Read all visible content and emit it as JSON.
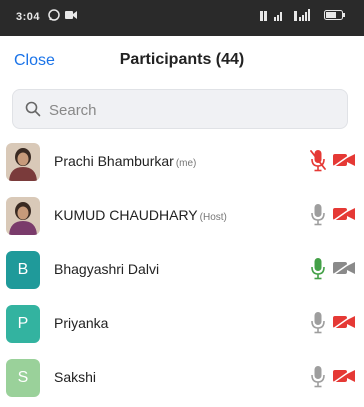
{
  "status_bar": {
    "time": "3:04",
    "left_icons": [
      "whatsapp-icon",
      "video-icon"
    ],
    "right_icons": [
      "signal-icon",
      "signal-icon",
      "battery-icon"
    ]
  },
  "header": {
    "close_label": "Close",
    "title": "Participants (44)"
  },
  "search": {
    "placeholder": "Search",
    "value": ""
  },
  "participants": [
    {
      "name": "Prachi Bhamburkar",
      "tag": "(me)",
      "avatar_type": "photo",
      "avatar_color": "#7a3b3b",
      "mic": "muted",
      "camera": "off"
    },
    {
      "name": "KUMUD CHAUDHARY",
      "tag": "(Host)",
      "avatar_type": "photo",
      "avatar_color": "#7a3b6b",
      "mic": "idle",
      "camera": "off"
    },
    {
      "name": "Bhagyashri Dalvi",
      "tag": "",
      "avatar_type": "letter",
      "letter": "B",
      "avatar_color": "#1f9a9a",
      "mic": "active",
      "camera": "off-gray"
    },
    {
      "name": "Priyanka",
      "tag": "",
      "avatar_type": "letter",
      "letter": "P",
      "avatar_color": "#33b3a0",
      "mic": "idle",
      "camera": "off"
    },
    {
      "name": "Sakshi",
      "tag": "",
      "avatar_type": "letter",
      "letter": "S",
      "avatar_color": "#9ad19a",
      "mic": "idle",
      "camera": "off"
    }
  ],
  "colors": {
    "accent": "#1a73e8",
    "muted_red": "#e53935",
    "mic_green": "#43a047",
    "mic_gray": "#9e9e9e"
  }
}
